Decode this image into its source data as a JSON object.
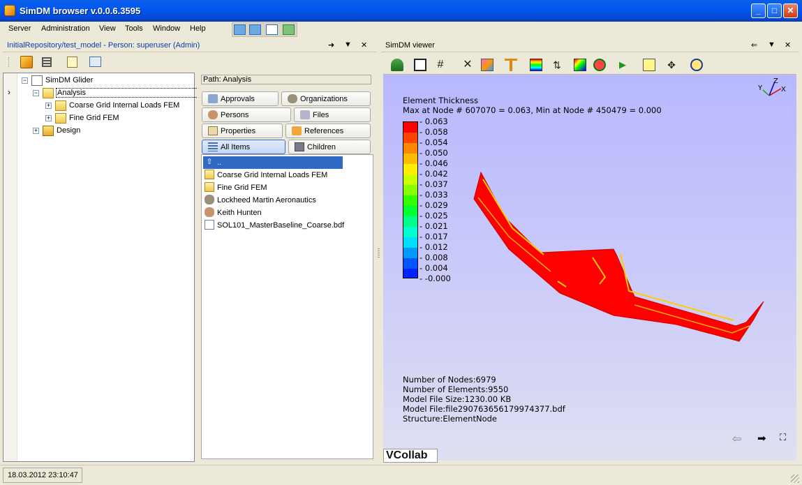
{
  "window": {
    "title": "SimDM browser v.0.0.6.3595",
    "minimize_glyph": "_",
    "maximize_glyph": "□",
    "close_glyph": "✕"
  },
  "menu": [
    "Server",
    "Administration",
    "View",
    "Tools",
    "Window",
    "Help"
  ],
  "left_panel": {
    "header": "InitialRepository/test_model - Person: superuser (Admin)",
    "header_icons": [
      "➜",
      "▼",
      "✕"
    ],
    "tree": [
      {
        "label": "SimDM Glider",
        "icon": "document-icon",
        "expander": "−"
      },
      {
        "label": "Analysis",
        "icon": "analysis-folder-icon",
        "expander": "−"
      },
      {
        "label": "Coarse Grid Internal Loads FEM",
        "icon": "analysis-folder-icon",
        "expander": "+"
      },
      {
        "label": "Fine Grid FEM",
        "icon": "analysis-folder-icon",
        "expander": "+"
      },
      {
        "label": "Design",
        "icon": "design-folder-icon",
        "expander": "+"
      }
    ],
    "gutter_marker": "›",
    "path": "Path: Analysis",
    "tabs": [
      {
        "label": "Approvals",
        "icon": "approvals-icon"
      },
      {
        "label": "Organizations",
        "icon": "organizations-icon"
      },
      {
        "label": "Persons",
        "icon": "person-icon"
      },
      {
        "label": "Files",
        "icon": "files-icon"
      },
      {
        "label": "Properties",
        "icon": "properties-icon"
      },
      {
        "label": "References",
        "icon": "references-icon"
      },
      {
        "label": "All Items",
        "icon": "all-items-icon"
      },
      {
        "label": "Children",
        "icon": "children-icon"
      }
    ],
    "items": [
      {
        "label": "..",
        "icon": "up-arrow-icon"
      },
      {
        "label": "Coarse Grid Internal Loads FEM",
        "icon": "analysis-folder-icon"
      },
      {
        "label": "Fine Grid FEM",
        "icon": "analysis-folder-icon"
      },
      {
        "label": "Lockheed Martin Aeronautics",
        "icon": "organizations-icon"
      },
      {
        "label": "Keith Hunten",
        "icon": "person-icon"
      },
      {
        "label": "SOL101_MasterBaseline_Coarse.bdf",
        "icon": "file-icon"
      }
    ]
  },
  "viewer": {
    "header": "SimDM viewer",
    "header_icons": [
      "⇐",
      "▼",
      "✕"
    ],
    "legend_title": "Element Thickness",
    "legend_subtitle": "Max at Node # 607070 = 0.063, Min at Node # 450479 = 0.000",
    "legend_values": [
      "0.063",
      "0.058",
      "0.054",
      "0.050",
      "0.046",
      "0.042",
      "0.037",
      "0.033",
      "0.029",
      "0.025",
      "0.021",
      "0.017",
      "0.012",
      "0.008",
      "0.004",
      "-0.000"
    ],
    "legend_colors": [
      "#ff0000",
      "#ff4400",
      "#ff8800",
      "#ffbb00",
      "#ffee00",
      "#ccff00",
      "#88ff00",
      "#33ff00",
      "#00ff33",
      "#00ff88",
      "#00ffcc",
      "#00ddff",
      "#0099ff",
      "#0055ff",
      "#0022ff",
      "#0000ff"
    ],
    "axis_labels": {
      "x": "X",
      "y": "Y",
      "z": "Z"
    },
    "info": [
      "Number of Nodes:6979",
      "Number of Elements:9550",
      "Model File Size:1230.00 KB",
      "Model File:file290763656179974377.bdf",
      "Structure:ElementNode"
    ],
    "nav": {
      "back": "⇦",
      "forward": "➡",
      "fullscreen": "⛶"
    },
    "logo": "VCollab",
    "colors": {
      "model": "#ff0000",
      "stripe": "#ffcc00",
      "background_top": "#b8b8ff"
    }
  },
  "status": {
    "datetime": "18.03.2012 23:10:47"
  }
}
